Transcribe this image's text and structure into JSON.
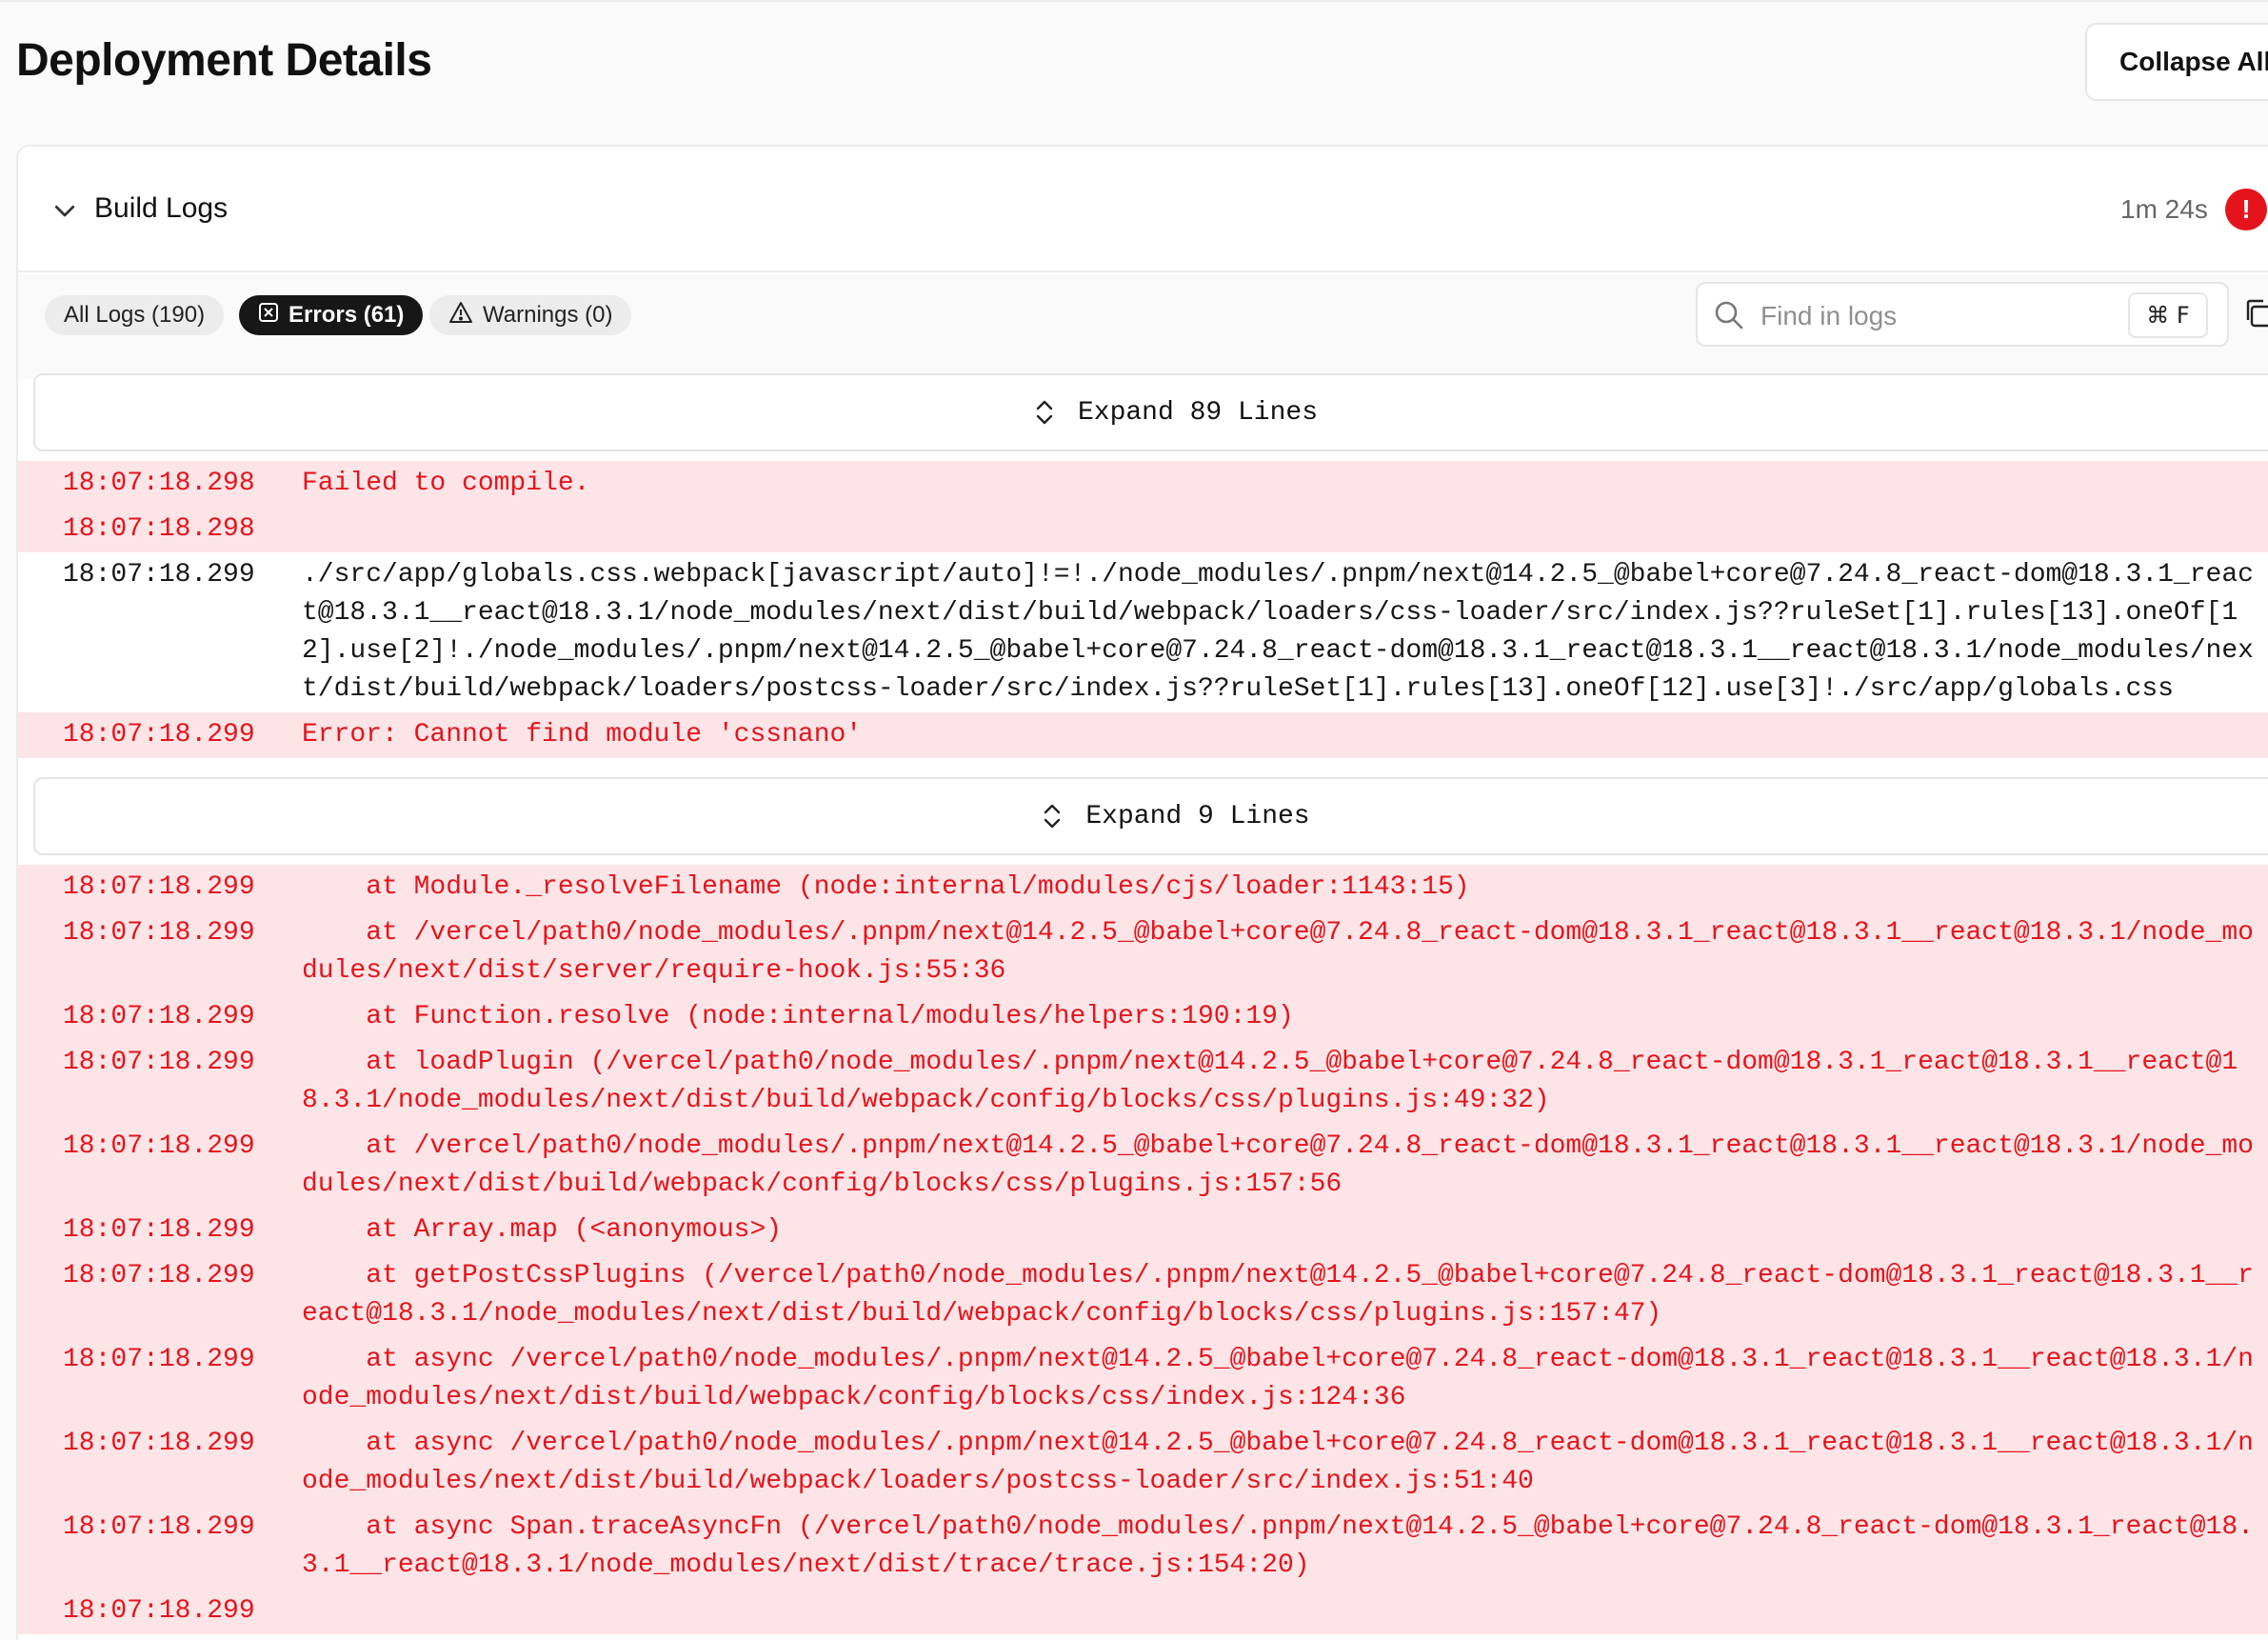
{
  "page": {
    "title": "Deployment Details",
    "collapse_label": "Collapse All"
  },
  "section": {
    "title": "Build Logs",
    "duration": "1m 24s",
    "status_icon": "!"
  },
  "filters": {
    "all": "All Logs (190)",
    "errors": "Errors (61)",
    "warnings": "Warnings (0)"
  },
  "search": {
    "placeholder": "Find in logs",
    "shortcut": "⌘ F"
  },
  "expanders": [
    {
      "label": "Expand 89 Lines"
    },
    {
      "label": "Expand 9 Lines"
    }
  ],
  "logs_top": [
    {
      "time": "18:07:18.298",
      "level": "error",
      "text": "Failed to compile."
    },
    {
      "time": "18:07:18.298",
      "level": "error",
      "text": ""
    },
    {
      "time": "18:07:18.299",
      "level": "normal",
      "text": "./src/app/globals.css.webpack[javascript/auto]!=!./node_modules/.pnpm/next@14.2.5_@babel+core@7.24.8_react-dom@18.3.1_react@18.3.1__react@18.3.1/node_modules/next/dist/build/webpack/loaders/css-loader/src/index.js??ruleSet[1].rules[13].oneOf[12].use[2]!./node_modules/.pnpm/next@14.2.5_@babel+core@7.24.8_react-dom@18.3.1_react@18.3.1__react@18.3.1/node_modules/next/dist/build/webpack/loaders/postcss-loader/src/index.js??ruleSet[1].rules[13].oneOf[12].use[3]!./src/app/globals.css"
    },
    {
      "time": "18:07:18.299",
      "level": "error",
      "text": "Error: Cannot find module 'cssnano'"
    }
  ],
  "logs_bottom": [
    {
      "time": "18:07:18.299",
      "level": "error",
      "text": "    at Module._resolveFilename (node:internal/modules/cjs/loader:1143:15)"
    },
    {
      "time": "18:07:18.299",
      "level": "error",
      "text": "    at /vercel/path0/node_modules/.pnpm/next@14.2.5_@babel+core@7.24.8_react-dom@18.3.1_react@18.3.1__react@18.3.1/node_modules/next/dist/server/require-hook.js:55:36"
    },
    {
      "time": "18:07:18.299",
      "level": "error",
      "text": "    at Function.resolve (node:internal/modules/helpers:190:19)"
    },
    {
      "time": "18:07:18.299",
      "level": "error",
      "text": "    at loadPlugin (/vercel/path0/node_modules/.pnpm/next@14.2.5_@babel+core@7.24.8_react-dom@18.3.1_react@18.3.1__react@18.3.1/node_modules/next/dist/build/webpack/config/blocks/css/plugins.js:49:32)"
    },
    {
      "time": "18:07:18.299",
      "level": "error",
      "text": "    at /vercel/path0/node_modules/.pnpm/next@14.2.5_@babel+core@7.24.8_react-dom@18.3.1_react@18.3.1__react@18.3.1/node_modules/next/dist/build/webpack/config/blocks/css/plugins.js:157:56"
    },
    {
      "time": "18:07:18.299",
      "level": "error",
      "text": "    at Array.map (<anonymous>)"
    },
    {
      "time": "18:07:18.299",
      "level": "error",
      "text": "    at getPostCssPlugins (/vercel/path0/node_modules/.pnpm/next@14.2.5_@babel+core@7.24.8_react-dom@18.3.1_react@18.3.1__react@18.3.1/node_modules/next/dist/build/webpack/config/blocks/css/plugins.js:157:47)"
    },
    {
      "time": "18:07:18.299",
      "level": "error",
      "text": "    at async /vercel/path0/node_modules/.pnpm/next@14.2.5_@babel+core@7.24.8_react-dom@18.3.1_react@18.3.1__react@18.3.1/node_modules/next/dist/build/webpack/config/blocks/css/index.js:124:36"
    },
    {
      "time": "18:07:18.299",
      "level": "error",
      "text": "    at async /vercel/path0/node_modules/.pnpm/next@14.2.5_@babel+core@7.24.8_react-dom@18.3.1_react@18.3.1__react@18.3.1/node_modules/next/dist/build/webpack/loaders/postcss-loader/src/index.js:51:40"
    },
    {
      "time": "18:07:18.299",
      "level": "error",
      "text": "    at async Span.traceAsyncFn (/vercel/path0/node_modules/.pnpm/next@14.2.5_@babel+core@7.24.8_react-dom@18.3.1_react@18.3.1__react@18.3.1/node_modules/next/dist/trace/trace.js:154:20)"
    },
    {
      "time": "18:07:18.299",
      "level": "error",
      "text": ""
    }
  ],
  "colors": {
    "error_text": "#e5141c",
    "error_bg": "#fde5e7",
    "accent": "#171717"
  }
}
